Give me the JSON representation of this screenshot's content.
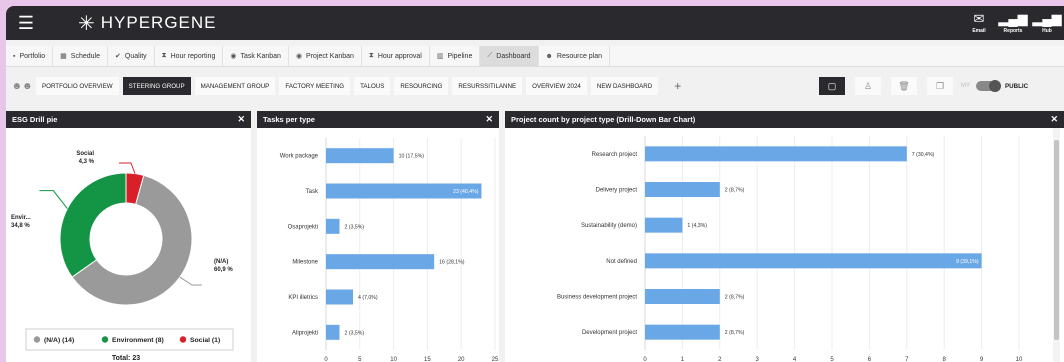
{
  "header": {
    "app_name": "HYPERGENE",
    "icons": [
      {
        "label": "Email",
        "icon": "email-icon"
      },
      {
        "label": "Reports",
        "icon": "signal-bars-icon"
      },
      {
        "label": "Hub",
        "icon": "signal-bars-icon"
      }
    ]
  },
  "nav": {
    "tabs": [
      {
        "label": "Portfolio",
        "icon": "briefcase-icon"
      },
      {
        "label": "Schedule",
        "icon": "calendar-icon"
      },
      {
        "label": "Quality",
        "icon": "check-icon"
      },
      {
        "label": "Hour reporting",
        "icon": "hourglass-icon"
      },
      {
        "label": "Task Kanban",
        "icon": "kanban-icon"
      },
      {
        "label": "Project Kanban",
        "icon": "kanban-icon"
      },
      {
        "label": "Hour approval",
        "icon": "hourglass-icon"
      },
      {
        "label": "Pipeline",
        "icon": "bar-chart-icon"
      },
      {
        "label": "Dashboard",
        "icon": "line-chart-icon",
        "active": true
      },
      {
        "label": "Resource plan",
        "icon": "people-icon"
      }
    ]
  },
  "dashboards": {
    "tabs": [
      {
        "label": "PORTFOLIO OVERVIEW"
      },
      {
        "label": "STEERING GROUP",
        "active": true
      },
      {
        "label": "MANAGEMENT GROUP"
      },
      {
        "label": "FACTORY MEETING"
      },
      {
        "label": "TALOUS"
      },
      {
        "label": "RESOURCING"
      },
      {
        "label": "RESURSSITILANNE"
      },
      {
        "label": "OVERVIEW 2024"
      },
      {
        "label": "NEW DASHBOARD"
      }
    ],
    "add_label": "+",
    "my_label": "MY",
    "public_label": "PUBLIC"
  },
  "panels": {
    "esg": {
      "title": "ESG Drill pie",
      "close": "✕",
      "total_label": "Total: 23"
    },
    "tasks": {
      "title": "Tasks per type",
      "close": "✕"
    },
    "projects": {
      "title": "Project count by project type (Drill-Down Bar Chart)",
      "close": "✕"
    }
  },
  "colors": {
    "header_bg": "#2a2a2e",
    "bar": "#6aa7e6",
    "pie_na": "#9a9a9a",
    "pie_env": "#149445",
    "pie_social": "#d9202a",
    "background": "#e7c6ea"
  },
  "chart_data": [
    {
      "type": "pie",
      "title": "ESG Drill pie",
      "slices": [
        {
          "name": "(N/A)",
          "value": 14,
          "label": "(N/A) 60,9 %",
          "legend": "(N/A) (14)",
          "color": "#9a9a9a"
        },
        {
          "name": "Environment",
          "value": 8,
          "label": "Envir... 34,8 %",
          "legend": "Environment (8)",
          "color": "#149445"
        },
        {
          "name": "Social",
          "value": 1,
          "label": "Social 4,3 %",
          "legend": "Social (1)",
          "color": "#d9202a"
        }
      ],
      "total": 23
    },
    {
      "type": "bar",
      "orientation": "horizontal",
      "title": "Tasks per type",
      "categories": [
        "Work package",
        "Task",
        "Osaprojekti",
        "Milestone",
        "KPI illetrics",
        "Aliprojekti"
      ],
      "values": [
        10,
        23,
        2,
        16,
        4,
        2
      ],
      "data_labels": [
        "10 (17,5%)",
        "23 (40,4%)",
        "2 (3,5%)",
        "16 (28,1%)",
        "4 (7,0%)",
        "2 (3,5%)"
      ],
      "xlim": [
        0,
        25
      ],
      "x_ticks": [
        0,
        5,
        10,
        15,
        20,
        25
      ],
      "grid": true
    },
    {
      "type": "bar",
      "orientation": "horizontal",
      "title": "Project count by project type (Drill-Down Bar Chart)",
      "categories": [
        "Research project",
        "Delivery project",
        "Sustainability (demo)",
        "Not defined",
        "Business development project",
        "Development project"
      ],
      "values": [
        7,
        2,
        1,
        9,
        2,
        2
      ],
      "data_labels": [
        "7 (30,4%)",
        "2 (8,7%)",
        "1 (4,3%)",
        "9 (39,1%)",
        "2 (8,7%)",
        "2 (8,7%)"
      ],
      "xlim": [
        0,
        10
      ],
      "x_ticks": [
        0,
        1,
        2,
        3,
        4,
        5,
        6,
        7,
        8,
        9,
        10
      ],
      "grid": true
    }
  ]
}
